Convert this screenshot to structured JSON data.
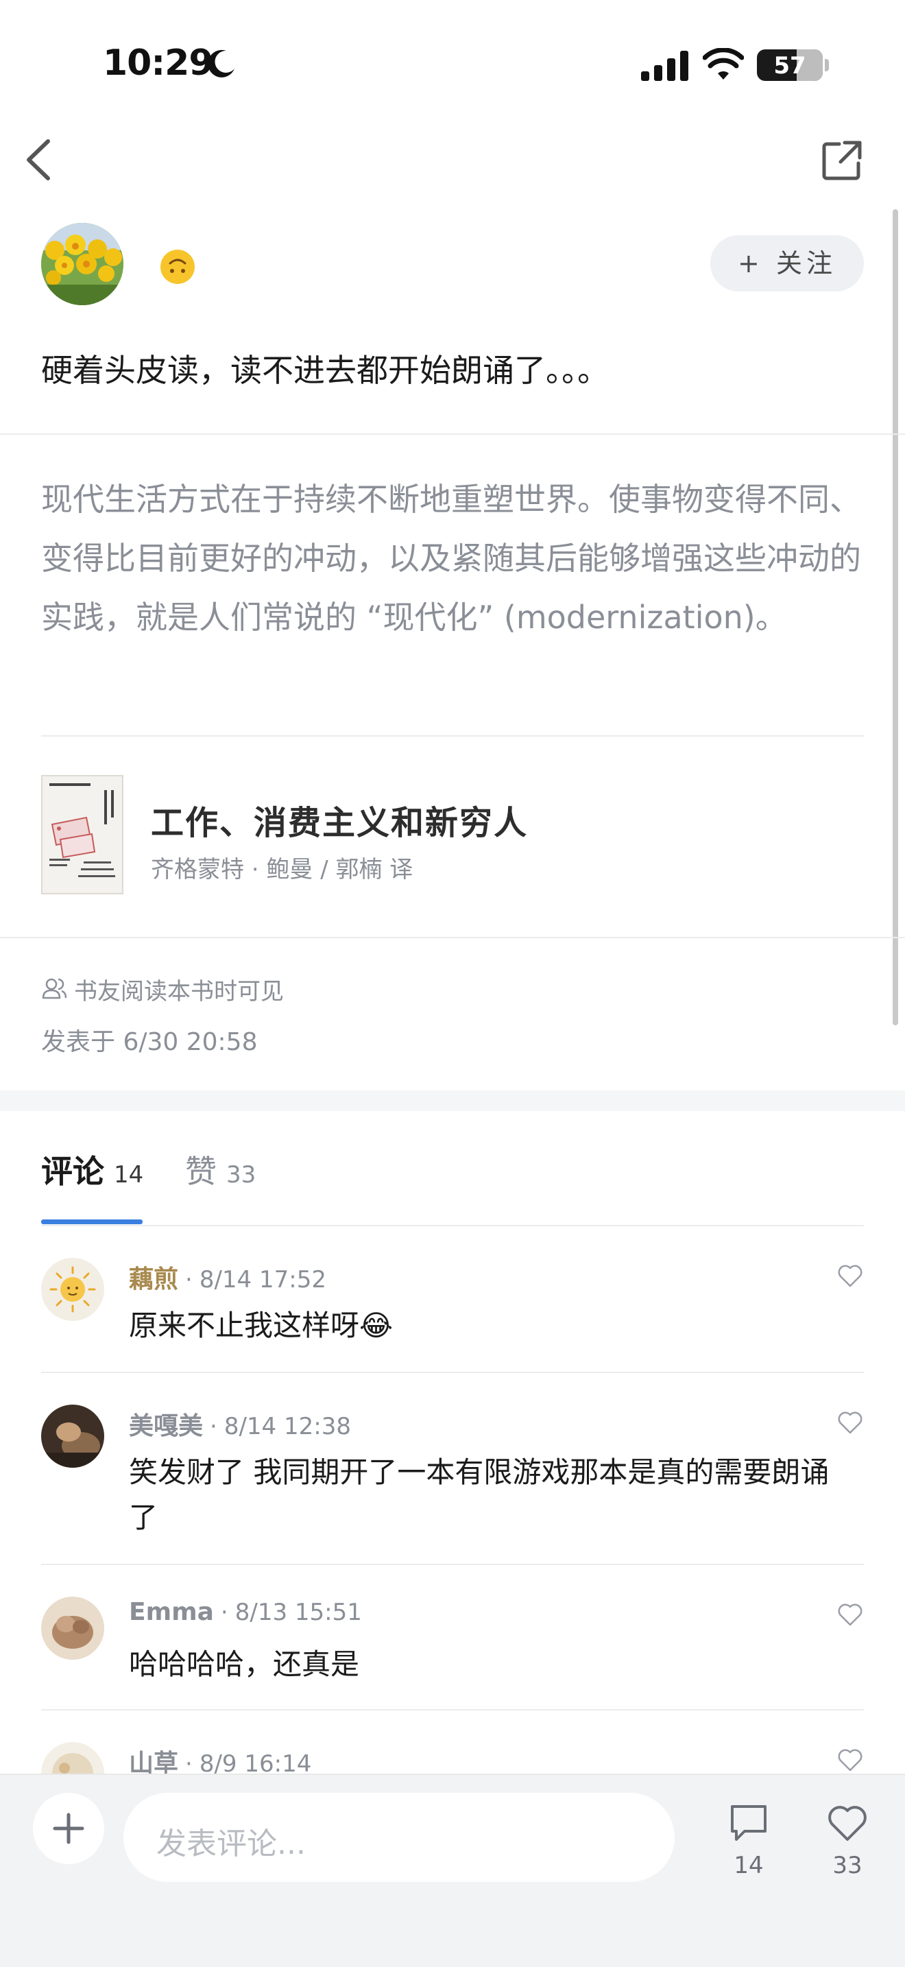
{
  "status_bar": {
    "time": "10:29",
    "battery": "57",
    "battery_level": 0.57
  },
  "post": {
    "follow_label": "+ 关注",
    "text": "硬着头皮读，读不进去都开始朗诵了。。。",
    "quote": "现代生活方式在于持续不断地重塑世界。使事物变得不同、变得比目前更好的冲动，以及紧随其后能够增强这些冲动的实践，就是人们常说的 “现代化” (modernization)。",
    "book": {
      "title": "工作、消费主义和新穷人",
      "author": "齐格蒙特 · 鲍曼 / 郭楠 译"
    },
    "visibility": "书友阅读本书时可见",
    "posted": "发表于 6/30 20:58"
  },
  "tabs": {
    "comments_label": "评论",
    "comments_count": "14",
    "likes_label": "赞",
    "likes_count": "33"
  },
  "comments": [
    {
      "name": "藕煎",
      "time": "8/14 17:52",
      "text": "原来不止我这样呀😂",
      "name_color": "#a88a4e"
    },
    {
      "name": "美嘎美",
      "time": "8/14 12:38",
      "text": "笑发财了 我同期开了一本有限游戏那本是真的需要朗诵了",
      "name_color": "#8a8e96"
    },
    {
      "name": "Emma",
      "time": "8/13 15:51",
      "text": "哈哈哈哈，还真是",
      "name_color": "#8a8e96"
    },
    {
      "name": "山草",
      "time": "8/9 16:14",
      "text": "",
      "name_color": "#8a8e96"
    }
  ],
  "bottom_bar": {
    "input_placeholder": "发表评论...",
    "comment_count": "14",
    "like_count": "33"
  }
}
